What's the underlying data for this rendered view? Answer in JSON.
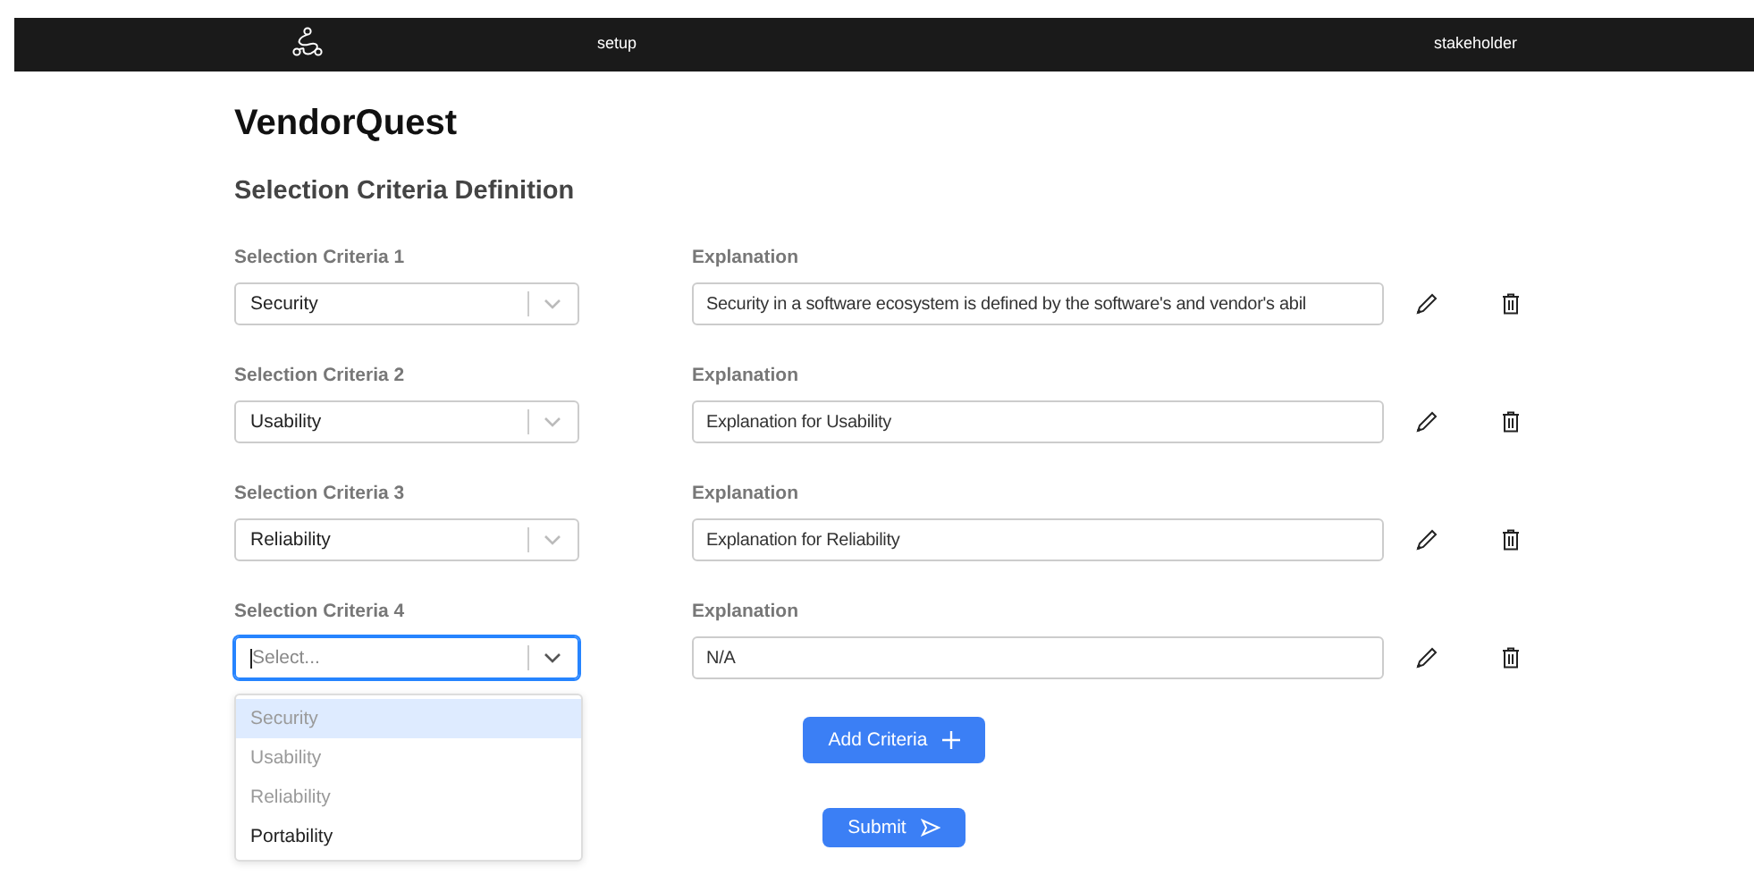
{
  "navbar": {
    "links": [
      "setup",
      "stakeholder"
    ]
  },
  "title": "VendorQuest",
  "subtitle": "Selection Criteria Definition",
  "criteria": [
    {
      "label": "Selection Criteria 1",
      "value": "Security",
      "focused": false,
      "explanation_label": "Explanation",
      "explanation": "Security in a software ecosystem is defined by the software's and vendor's abil"
    },
    {
      "label": "Selection Criteria 2",
      "value": "Usability",
      "focused": false,
      "explanation_label": "Explanation",
      "explanation": "Explanation for Usability"
    },
    {
      "label": "Selection Criteria 3",
      "value": "Reliability",
      "focused": false,
      "explanation_label": "Explanation",
      "explanation": "Explanation for Reliability"
    },
    {
      "label": "Selection Criteria 4",
      "placeholder": "Select...",
      "focused": true,
      "explanation_label": "Explanation",
      "explanation": "N/A"
    }
  ],
  "dropdown": {
    "options": [
      {
        "label": "Security",
        "disabled": true,
        "selected": true
      },
      {
        "label": "Usability",
        "disabled": true,
        "selected": false
      },
      {
        "label": "Reliability",
        "disabled": true,
        "selected": false
      },
      {
        "label": "Portability",
        "disabled": false,
        "selected": false
      }
    ]
  },
  "buttons": {
    "add": "Add Criteria",
    "submit": "Submit"
  }
}
